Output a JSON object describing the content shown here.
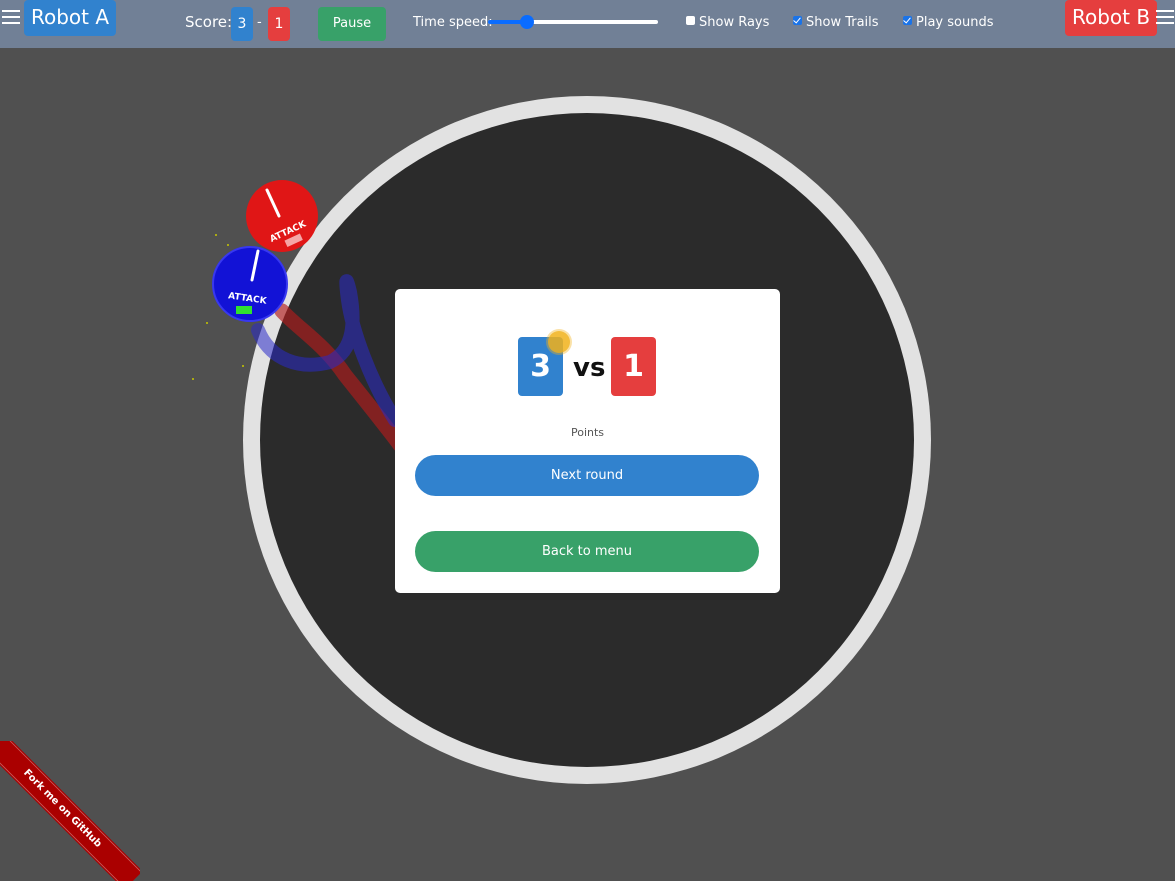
{
  "topbar": {
    "robot_a_label": "Robot A",
    "robot_b_label": "Robot B",
    "score_label": "Score:",
    "score_a": "3",
    "score_separator": "-",
    "score_b": "1",
    "pause_label": "Pause",
    "time_speed_label": "Time speed:",
    "time_speed_value": 0.23,
    "options": [
      {
        "label": "Show Rays",
        "checked": false
      },
      {
        "label": "Show Trails",
        "checked": true
      },
      {
        "label": "Play sounds",
        "checked": true
      }
    ]
  },
  "robots": {
    "a": {
      "status": "ATTACK",
      "color": "#1e1edc"
    },
    "b": {
      "status": "ATTACK",
      "color": "#e01616"
    }
  },
  "result": {
    "score_a": "3",
    "vs_label": "vs",
    "score_b": "1",
    "points_label": "Points",
    "next_round_label": "Next round",
    "back_to_menu_label": "Back to menu"
  },
  "ribbon": {
    "label": "Fork me on GitHub"
  },
  "colors": {
    "blue": "#3182ce",
    "red": "#e53e3e",
    "green": "#38a169",
    "topbar": "#718096",
    "background": "#505050",
    "arena": "#2b2b2b",
    "arena_ring": "#e2e2e2"
  }
}
